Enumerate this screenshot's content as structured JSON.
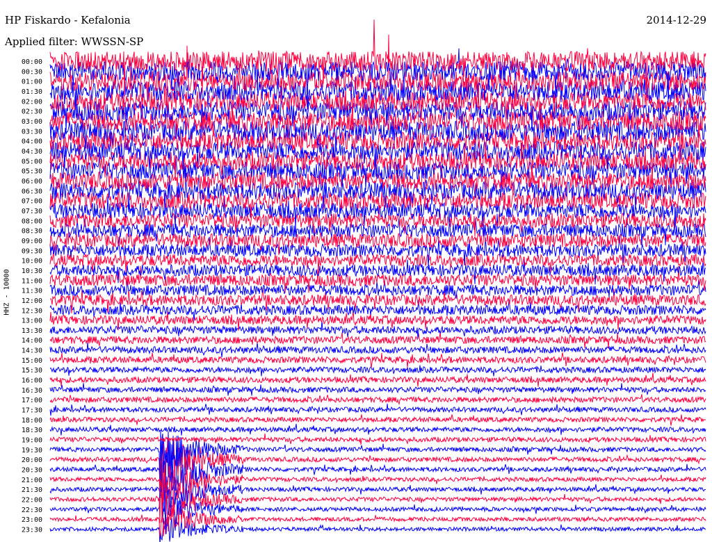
{
  "header": {
    "station": "HP Fiskardo - Kefalonia",
    "filter": "Applied filter: WWSSN-SP",
    "date": "2014-12-29"
  },
  "chart_data": {
    "type": "line",
    "subtype": "helicorder",
    "title": "HP Fiskardo - Kefalonia",
    "ylabel": "HHZ - 10000",
    "row_labels": [
      "00:00",
      "00:30",
      "01:00",
      "01:30",
      "02:00",
      "02:30",
      "03:00",
      "03:30",
      "04:00",
      "04:30",
      "05:00",
      "05:30",
      "06:00",
      "06:30",
      "07:00",
      "07:30",
      "08:00",
      "08:30",
      "09:00",
      "09:30",
      "10:00",
      "10:30",
      "11:00",
      "11:30",
      "12:00",
      "12:30",
      "13:00",
      "13:30",
      "14:00",
      "14:30",
      "15:00",
      "15:30",
      "16:00",
      "16:30",
      "17:00",
      "17:30",
      "18:00",
      "18:30",
      "19:00",
      "19:30",
      "20:00",
      "20:30",
      "21:00",
      "21:30",
      "22:00",
      "22:30",
      "23:00",
      "23:30"
    ],
    "series_colors": [
      "#ff0040",
      "#0000ff"
    ],
    "noise_level_relative": [
      1.0,
      1.0,
      1.0,
      1.0,
      1.0,
      1.0,
      1.0,
      1.0,
      0.95,
      0.95,
      0.95,
      0.9,
      0.9,
      0.9,
      0.85,
      0.8,
      0.75,
      0.7,
      0.7,
      0.65,
      0.6,
      0.6,
      0.6,
      0.55,
      0.55,
      0.5,
      0.45,
      0.4,
      0.38,
      0.35,
      0.33,
      0.3,
      0.3,
      0.28,
      0.28,
      0.26,
      0.25,
      0.25,
      0.25,
      0.24,
      0.24,
      0.23,
      0.22,
      0.22,
      0.22,
      0.21,
      0.21,
      0.2
    ],
    "event": {
      "start_row_label": "19:30",
      "strongest_row_label": "20:30",
      "minute_offset": 5
    }
  }
}
